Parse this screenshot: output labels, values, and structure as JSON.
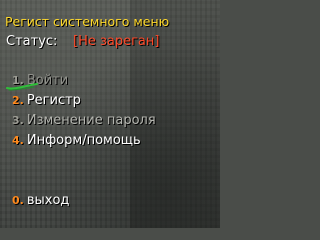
{
  "menu": {
    "title": "Регист системного меню",
    "status_label": "Статус:",
    "status_value": "[Не зареган]",
    "items": [
      {
        "num": "1.",
        "label": "Войти"
      },
      {
        "num": "2.",
        "label": "Регистр"
      },
      {
        "num": "3.",
        "label": "Изменение пароля"
      },
      {
        "num": "4.",
        "label": "Информ/помощь"
      }
    ],
    "exit": {
      "num": "0.",
      "label": "выход"
    }
  },
  "colors": {
    "title": "#ffd92a",
    "status_value": "#ff4a2a",
    "number": "#ff8a1e",
    "active_text": "#ffffff",
    "disabled_text": "#8f908a",
    "underline_stroke": "#2fbf3a"
  }
}
